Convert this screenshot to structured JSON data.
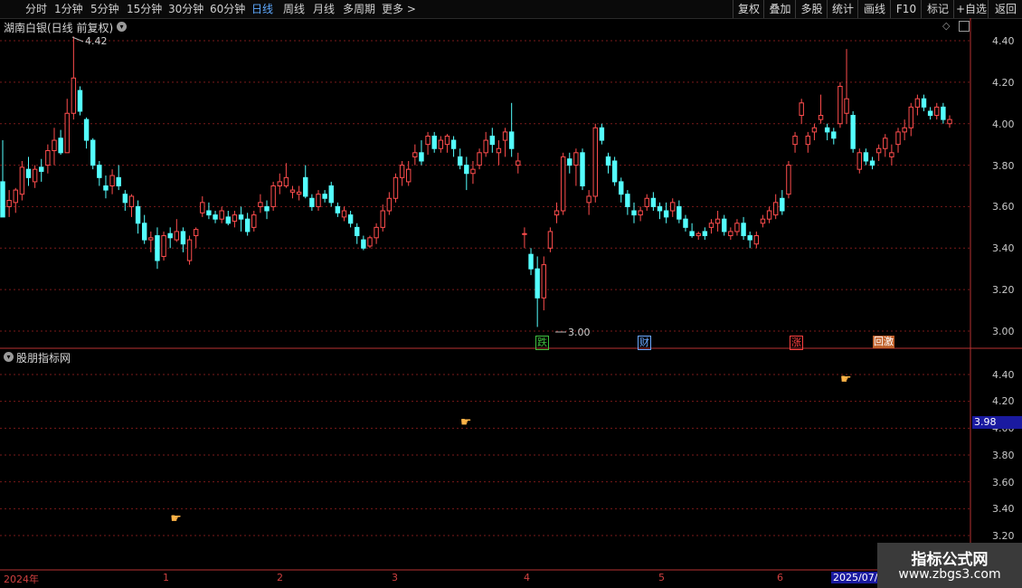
{
  "toolbar": {
    "timeframes": [
      "分时",
      "1分钟",
      "5分钟",
      "15分钟",
      "30分钟",
      "60分钟",
      "日线",
      "周线",
      "月线",
      "多周期"
    ],
    "active_timeframe": "日线",
    "more": "更多",
    "right_buttons": [
      "复权",
      "叠加",
      "多股",
      "统计",
      "画线",
      "F10",
      "标记",
      "+自选",
      "返回"
    ]
  },
  "main_panel": {
    "title": "湖南白银(日线 前复权)",
    "high_label": "4.42",
    "low_label": "3.00",
    "y_axis": [
      "4.40",
      "4.20",
      "4.00",
      "3.80",
      "3.60",
      "3.40",
      "3.20",
      "3.00"
    ],
    "events": [
      {
        "label": "跌",
        "color": "#3fbf3f"
      },
      {
        "label": "财",
        "color": "#6aa8ff"
      },
      {
        "label": "涨",
        "color": "#ff4040"
      },
      {
        "label": "回激",
        "color": "#ff9a30"
      }
    ]
  },
  "indicator_panel": {
    "title": "股朋指标网",
    "y_axis": [
      "4.40",
      "4.20",
      "4.00",
      "3.80",
      "3.60",
      "3.40",
      "3.20"
    ],
    "current_value": "3.98"
  },
  "x_axis": {
    "labels": [
      "2024年",
      "1",
      "2",
      "3",
      "4",
      "5",
      "6",
      "2025/07/0"
    ]
  },
  "watermark": {
    "line1": "指标公式网",
    "line2": "www.zbgs3.com"
  },
  "colors": {
    "up": "#ff4d4d",
    "down": "#54ffff",
    "grid": "#7a1a1a",
    "axis": "#b83232"
  },
  "chart_data": {
    "type": "candlestick",
    "ylim": [
      2.92,
      4.5
    ],
    "candles": [
      [
        3.72,
        3.92,
        3.55,
        3.55
      ],
      [
        3.6,
        3.68,
        3.55,
        3.63
      ],
      [
        3.62,
        3.69,
        3.57,
        3.68
      ],
      [
        3.66,
        3.82,
        3.63,
        3.79
      ],
      [
        3.78,
        3.84,
        3.7,
        3.74
      ],
      [
        3.72,
        3.8,
        3.69,
        3.78
      ],
      [
        3.79,
        3.83,
        3.72,
        3.77
      ],
      [
        3.8,
        3.9,
        3.76,
        3.87
      ],
      [
        3.87,
        3.98,
        3.8,
        3.92
      ],
      [
        3.93,
        3.97,
        3.85,
        3.86
      ],
      [
        3.86,
        4.12,
        3.86,
        4.05
      ],
      [
        4.05,
        4.42,
        4.02,
        4.22
      ],
      [
        4.16,
        4.18,
        4.04,
        4.06
      ],
      [
        4.02,
        4.03,
        3.88,
        3.92
      ],
      [
        3.92,
        3.93,
        3.78,
        3.8
      ],
      [
        3.8,
        3.82,
        3.7,
        3.74
      ],
      [
        3.7,
        3.75,
        3.64,
        3.68
      ],
      [
        3.7,
        3.78,
        3.66,
        3.75
      ],
      [
        3.74,
        3.8,
        3.68,
        3.7
      ],
      [
        3.66,
        3.68,
        3.58,
        3.62
      ],
      [
        3.6,
        3.66,
        3.55,
        3.65
      ],
      [
        3.6,
        3.63,
        3.47,
        3.52
      ],
      [
        3.52,
        3.56,
        3.42,
        3.44
      ],
      [
        3.44,
        3.48,
        3.38,
        3.45
      ],
      [
        3.46,
        3.5,
        3.3,
        3.34
      ],
      [
        3.36,
        3.48,
        3.34,
        3.46
      ],
      [
        3.47,
        3.5,
        3.4,
        3.45
      ],
      [
        3.44,
        3.54,
        3.43,
        3.48
      ],
      [
        3.48,
        3.5,
        3.38,
        3.42
      ],
      [
        3.34,
        3.46,
        3.32,
        3.44
      ],
      [
        3.46,
        3.5,
        3.4,
        3.49
      ],
      [
        3.57,
        3.65,
        3.55,
        3.62
      ],
      [
        3.58,
        3.62,
        3.54,
        3.56
      ],
      [
        3.56,
        3.58,
        3.52,
        3.54
      ],
      [
        3.54,
        3.6,
        3.52,
        3.58
      ],
      [
        3.55,
        3.58,
        3.51,
        3.52
      ],
      [
        3.53,
        3.58,
        3.5,
        3.56
      ],
      [
        3.56,
        3.6,
        3.48,
        3.54
      ],
      [
        3.54,
        3.57,
        3.46,
        3.48
      ],
      [
        3.5,
        3.58,
        3.48,
        3.56
      ],
      [
        3.6,
        3.66,
        3.57,
        3.62
      ],
      [
        3.6,
        3.63,
        3.54,
        3.58
      ],
      [
        3.6,
        3.72,
        3.58,
        3.7
      ],
      [
        3.7,
        3.76,
        3.66,
        3.72
      ],
      [
        3.7,
        3.81,
        3.69,
        3.74
      ],
      [
        3.67,
        3.7,
        3.64,
        3.68
      ],
      [
        3.66,
        3.7,
        3.63,
        3.67
      ],
      [
        3.74,
        3.8,
        3.64,
        3.65
      ],
      [
        3.64,
        3.66,
        3.58,
        3.6
      ],
      [
        3.6,
        3.68,
        3.58,
        3.66
      ],
      [
        3.66,
        3.68,
        3.62,
        3.64
      ],
      [
        3.7,
        3.72,
        3.6,
        3.62
      ],
      [
        3.6,
        3.62,
        3.55,
        3.57
      ],
      [
        3.55,
        3.6,
        3.53,
        3.58
      ],
      [
        3.56,
        3.58,
        3.5,
        3.52
      ],
      [
        3.5,
        3.52,
        3.42,
        3.46
      ],
      [
        3.44,
        3.46,
        3.39,
        3.4
      ],
      [
        3.41,
        3.46,
        3.4,
        3.45
      ],
      [
        3.45,
        3.52,
        3.42,
        3.5
      ],
      [
        3.5,
        3.61,
        3.48,
        3.58
      ],
      [
        3.58,
        3.67,
        3.56,
        3.64
      ],
      [
        3.64,
        3.76,
        3.62,
        3.74
      ],
      [
        3.74,
        3.82,
        3.7,
        3.8
      ],
      [
        3.72,
        3.82,
        3.7,
        3.78
      ],
      [
        3.84,
        3.9,
        3.8,
        3.86
      ],
      [
        3.86,
        3.92,
        3.8,
        3.82
      ],
      [
        3.9,
        3.96,
        3.85,
        3.94
      ],
      [
        3.94,
        3.96,
        3.86,
        3.88
      ],
      [
        3.88,
        3.94,
        3.86,
        3.92
      ],
      [
        3.9,
        3.95,
        3.86,
        3.94
      ],
      [
        3.92,
        3.94,
        3.84,
        3.88
      ],
      [
        3.84,
        3.88,
        3.78,
        3.8
      ],
      [
        3.8,
        3.84,
        3.68,
        3.76
      ],
      [
        3.76,
        3.82,
        3.71,
        3.78
      ],
      [
        3.8,
        3.88,
        3.78,
        3.86
      ],
      [
        3.86,
        3.96,
        3.84,
        3.92
      ],
      [
        3.94,
        3.98,
        3.86,
        3.9
      ],
      [
        3.86,
        3.92,
        3.8,
        3.88
      ],
      [
        3.92,
        3.98,
        3.84,
        3.96
      ],
      [
        3.96,
        4.1,
        3.84,
        3.88
      ],
      [
        3.8,
        3.86,
        3.76,
        3.82
      ],
      [
        3.47,
        3.5,
        3.4,
        3.47
      ],
      [
        3.37,
        3.4,
        3.27,
        3.3
      ],
      [
        3.3,
        3.36,
        3.02,
        3.16
      ],
      [
        3.16,
        3.36,
        3.1,
        3.32
      ],
      [
        3.4,
        3.5,
        3.38,
        3.48
      ],
      [
        3.56,
        3.62,
        3.52,
        3.58
      ],
      [
        3.58,
        3.86,
        3.56,
        3.84
      ],
      [
        3.83,
        3.86,
        3.76,
        3.8
      ],
      [
        3.8,
        3.88,
        3.7,
        3.86
      ],
      [
        3.86,
        3.88,
        3.68,
        3.7
      ],
      [
        3.62,
        3.68,
        3.56,
        3.65
      ],
      [
        3.65,
        4.0,
        3.62,
        3.98
      ],
      [
        3.98,
        4.0,
        3.9,
        3.92
      ],
      [
        3.84,
        3.86,
        3.76,
        3.8
      ],
      [
        3.82,
        3.84,
        3.7,
        3.72
      ],
      [
        3.72,
        3.74,
        3.62,
        3.66
      ],
      [
        3.66,
        3.68,
        3.56,
        3.6
      ],
      [
        3.58,
        3.62,
        3.52,
        3.56
      ],
      [
        3.56,
        3.6,
        3.53,
        3.58
      ],
      [
        3.6,
        3.66,
        3.58,
        3.64
      ],
      [
        3.64,
        3.67,
        3.58,
        3.6
      ],
      [
        3.6,
        3.62,
        3.54,
        3.58
      ],
      [
        3.58,
        3.62,
        3.52,
        3.55
      ],
      [
        3.58,
        3.64,
        3.55,
        3.62
      ],
      [
        3.6,
        3.63,
        3.52,
        3.54
      ],
      [
        3.54,
        3.56,
        3.48,
        3.5
      ],
      [
        3.48,
        3.52,
        3.45,
        3.46
      ],
      [
        3.46,
        3.48,
        3.44,
        3.47
      ],
      [
        3.48,
        3.5,
        3.44,
        3.46
      ],
      [
        3.5,
        3.54,
        3.47,
        3.52
      ],
      [
        3.52,
        3.58,
        3.48,
        3.54
      ],
      [
        3.54,
        3.56,
        3.46,
        3.48
      ],
      [
        3.46,
        3.5,
        3.44,
        3.48
      ],
      [
        3.48,
        3.54,
        3.46,
        3.52
      ],
      [
        3.52,
        3.55,
        3.44,
        3.46
      ],
      [
        3.46,
        3.48,
        3.4,
        3.44
      ],
      [
        3.42,
        3.48,
        3.4,
        3.46
      ],
      [
        3.52,
        3.56,
        3.5,
        3.54
      ],
      [
        3.54,
        3.6,
        3.52,
        3.58
      ],
      [
        3.56,
        3.66,
        3.54,
        3.62
      ],
      [
        3.64,
        3.68,
        3.56,
        3.58
      ],
      [
        3.66,
        3.82,
        3.64,
        3.8
      ],
      [
        3.9,
        3.96,
        3.86,
        3.94
      ],
      [
        4.04,
        4.12,
        4.0,
        4.1
      ],
      [
        3.9,
        3.96,
        3.86,
        3.94
      ],
      [
        3.96,
        4.0,
        3.92,
        3.98
      ],
      [
        4.02,
        4.14,
        4.0,
        4.04
      ],
      [
        3.98,
        4.0,
        3.92,
        3.96
      ],
      [
        3.96,
        3.98,
        3.9,
        3.93
      ],
      [
        4.0,
        4.2,
        3.98,
        4.18
      ],
      [
        4.05,
        4.36,
        4.0,
        4.12
      ],
      [
        4.04,
        4.06,
        3.86,
        3.88
      ],
      [
        3.78,
        3.88,
        3.76,
        3.86
      ],
      [
        3.86,
        3.88,
        3.8,
        3.82
      ],
      [
        3.82,
        3.84,
        3.78,
        3.8
      ],
      [
        3.86,
        3.9,
        3.82,
        3.88
      ],
      [
        3.88,
        3.95,
        3.84,
        3.93
      ],
      [
        3.84,
        3.9,
        3.8,
        3.86
      ],
      [
        3.9,
        3.98,
        3.86,
        3.96
      ],
      [
        3.96,
        4.02,
        3.92,
        3.98
      ],
      [
        3.98,
        4.1,
        3.94,
        4.08
      ],
      [
        4.08,
        4.14,
        4.04,
        4.12
      ],
      [
        4.12,
        4.14,
        4.06,
        4.08
      ],
      [
        4.06,
        4.08,
        4.02,
        4.04
      ],
      [
        4.04,
        4.1,
        4.02,
        4.08
      ],
      [
        4.08,
        4.1,
        4.0,
        4.02
      ],
      [
        4.0,
        4.04,
        3.98,
        4.02
      ]
    ],
    "markers": [
      {
        "index": 27,
        "value": 3.33
      },
      {
        "index": 72,
        "value": 4.05
      },
      {
        "index": 131,
        "value": 4.37
      }
    ]
  }
}
